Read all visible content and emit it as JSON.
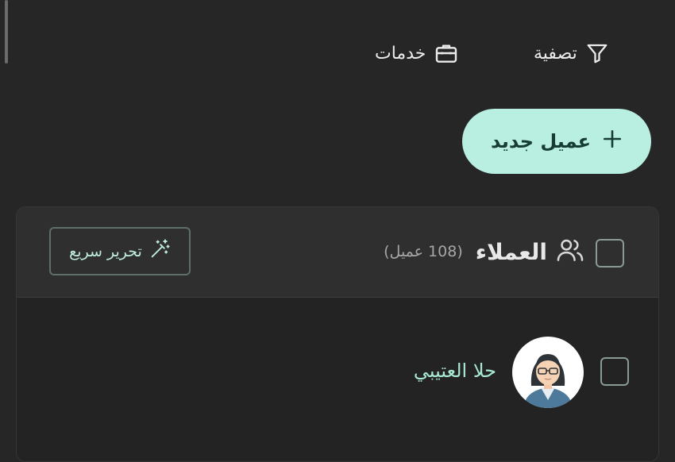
{
  "toolbar": {
    "filter_label": "تصفية",
    "services_label": "خدمات"
  },
  "new_client": {
    "label": "عميل جديد"
  },
  "clients_card": {
    "title": "العملاء",
    "count": "(108 عميل)",
    "quick_edit_label": "تحرير سريع"
  },
  "clients": [
    {
      "name": "حلا العتيبي"
    }
  ],
  "colors": {
    "background": "#262626",
    "accent": "#b8efe0",
    "accent_text": "#a9ead7"
  }
}
